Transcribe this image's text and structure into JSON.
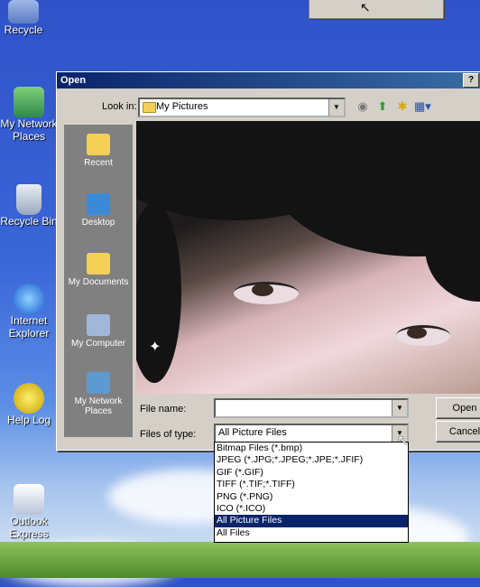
{
  "desktop": {
    "icons": [
      {
        "label": "Recycle",
        "name": "recycle-top-icon"
      },
      {
        "label": "My Network Places",
        "name": "network-places-icon"
      },
      {
        "label": "Recycle Bin",
        "name": "recycle-bin-icon"
      },
      {
        "label": "Internet Explorer",
        "name": "internet-explorer-icon"
      },
      {
        "label": "Help Log",
        "name": "help-icon"
      },
      {
        "label": "Outlook Express",
        "name": "outlook-express-icon"
      }
    ]
  },
  "dialog": {
    "title": "Open",
    "help": "?",
    "look_in_label": "Look in:",
    "look_in_value": "My Pictures",
    "places": [
      {
        "label": "Recent",
        "icon": "recent-folder-icon"
      },
      {
        "label": "Desktop",
        "icon": "desktop-icon"
      },
      {
        "label": "My Documents",
        "icon": "my-documents-icon"
      },
      {
        "label": "My Computer",
        "icon": "my-computer-icon"
      },
      {
        "label": "My Network Places",
        "icon": "my-network-icon"
      }
    ],
    "file_name_label": "File name:",
    "file_name_value": "",
    "files_of_type_label": "Files of type:",
    "files_of_type_value": "All Picture Files",
    "open_button": "Open",
    "cancel_button": "Cancel",
    "file_types": [
      "Bitmap Files (*.bmp)",
      "JPEG (*.JPG;*.JPEG;*.JPE;*.JFIF)",
      "GIF (*.GIF)",
      "TIFF (*.TIF;*.TIFF)",
      "PNG (*.PNG)",
      "ICO (*.ICO)",
      "All Picture Files",
      "All Files"
    ],
    "selected_file_type": "All Picture Files"
  },
  "colors": {
    "titlebar": "#0a246a",
    "selection": "#0a246a",
    "dialog_face": "#d4d0c8"
  }
}
